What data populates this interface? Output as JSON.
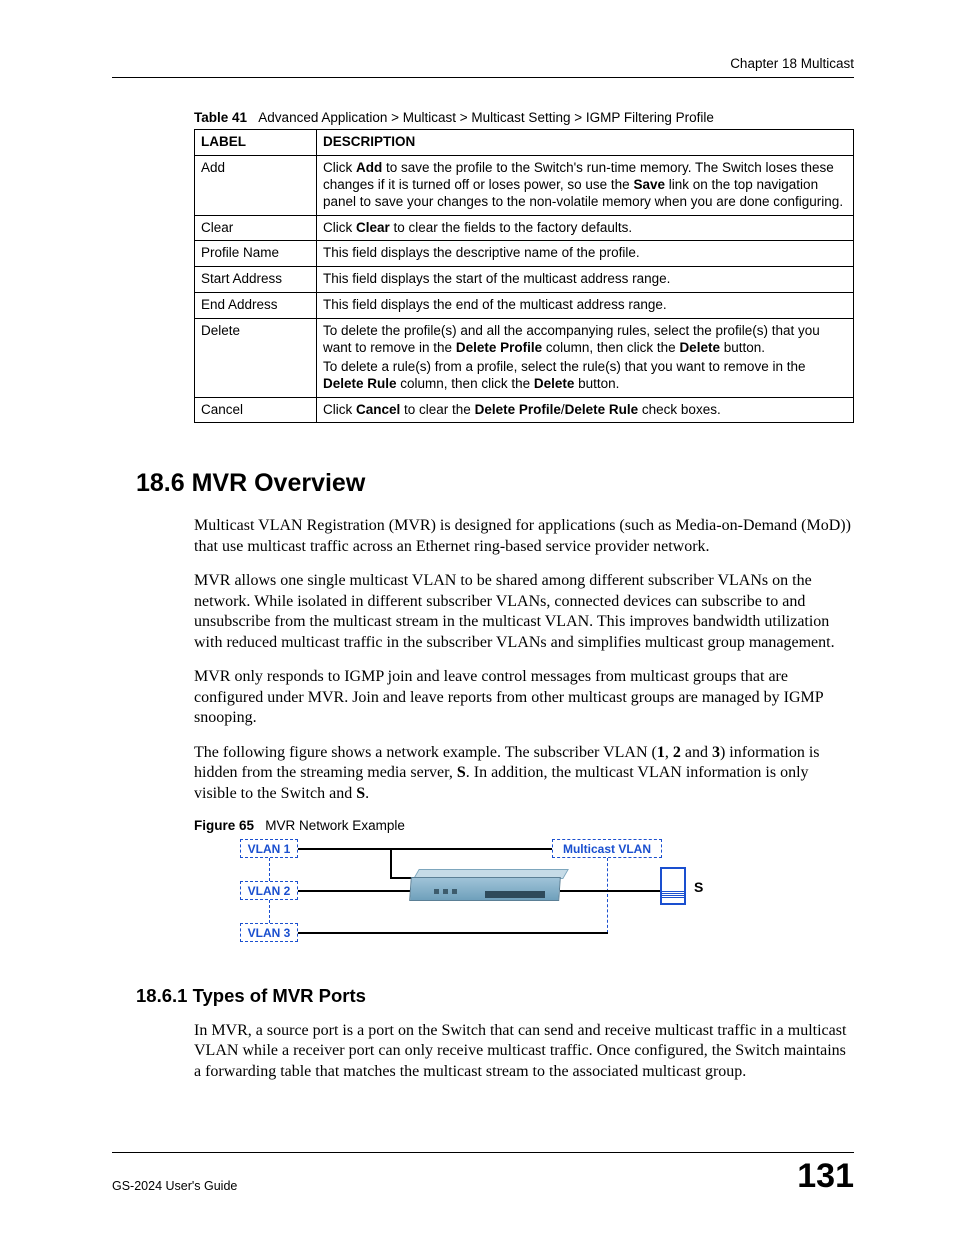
{
  "header": {
    "chapter": "Chapter 18 Multicast"
  },
  "table": {
    "caption_label": "Table 41",
    "caption_text": "Advanced Application > Multicast > Multicast Setting > IGMP Filtering Profile",
    "head": {
      "label": "LABEL",
      "desc": "DESCRIPTION"
    },
    "rows": [
      {
        "label": "Add",
        "paras": [
          "Click <b>Add</b> to save the profile to the Switch's run-time memory. The Switch loses these changes if it is turned off or loses power, so use the <b>Save</b> link on the top navigation panel to save your changes to the non-volatile memory when you are done configuring."
        ]
      },
      {
        "label": "Clear",
        "paras": [
          "Click <b>Clear</b> to clear the fields to the factory defaults."
        ]
      },
      {
        "label": "Profile Name",
        "paras": [
          "This field displays the descriptive name of the profile."
        ]
      },
      {
        "label": "Start Address",
        "paras": [
          "This field displays the start of the multicast address range."
        ]
      },
      {
        "label": "End Address",
        "paras": [
          "This field displays the end of the multicast address range."
        ]
      },
      {
        "label": "Delete",
        "paras": [
          "To delete the profile(s) and all the accompanying rules, select the profile(s) that you want to remove in the <b>Delete Profile</b> column, then click the <b>Delete</b> button.",
          "To delete a rule(s) from a profile, select the rule(s) that you want to remove in the <b>Delete Rule</b> column, then click the <b>Delete</b> button."
        ]
      },
      {
        "label": "Cancel",
        "paras": [
          "Click <b>Cancel</b> to clear the <b>Delete Profile</b>/<b>Delete Rule</b> check boxes."
        ]
      }
    ]
  },
  "section": {
    "heading": "18.6  MVR Overview",
    "paras": [
      "Multicast VLAN Registration (MVR) is designed for applications (such as Media-on-Demand (MoD)) that use multicast traffic across an Ethernet ring-based service provider network.",
      "MVR allows one single multicast VLAN to be shared among different subscriber VLANs on the network. While isolated in different subscriber VLANs, connected devices can subscribe to and unsubscribe from the multicast stream in the multicast VLAN. This improves bandwidth utilization with reduced multicast traffic in the subscriber VLANs and simplifies multicast group management.",
      "MVR only responds to IGMP join and leave control messages from multicast groups that are configured under MVR. Join and leave reports from other multicast groups are managed by IGMP snooping.",
      "The following figure shows a network example. The subscriber VLAN (<b>1</b>, <b>2</b> and <b>3</b>) information is hidden from the streaming media server, <b>S</b>. In addition, the multicast VLAN information is only visible to the Switch and <b>S</b>."
    ]
  },
  "figure": {
    "caption_label": "Figure 65",
    "caption_text": "MVR Network Example",
    "vlan1": "VLAN 1",
    "vlan2": "VLAN 2",
    "vlan3": "VLAN 3",
    "mcast": "Multicast VLAN",
    "server": "S"
  },
  "subsection": {
    "heading": "18.6.1  Types of MVR Ports",
    "para": "In MVR, a source port is a port on the Switch that can send and receive multicast traffic in a multicast VLAN while a receiver port can only receive multicast traffic. Once configured, the Switch maintains a forwarding table that matches the multicast stream to the associated multicast group."
  },
  "footer": {
    "guide": "GS-2024 User's Guide",
    "page": "131"
  }
}
